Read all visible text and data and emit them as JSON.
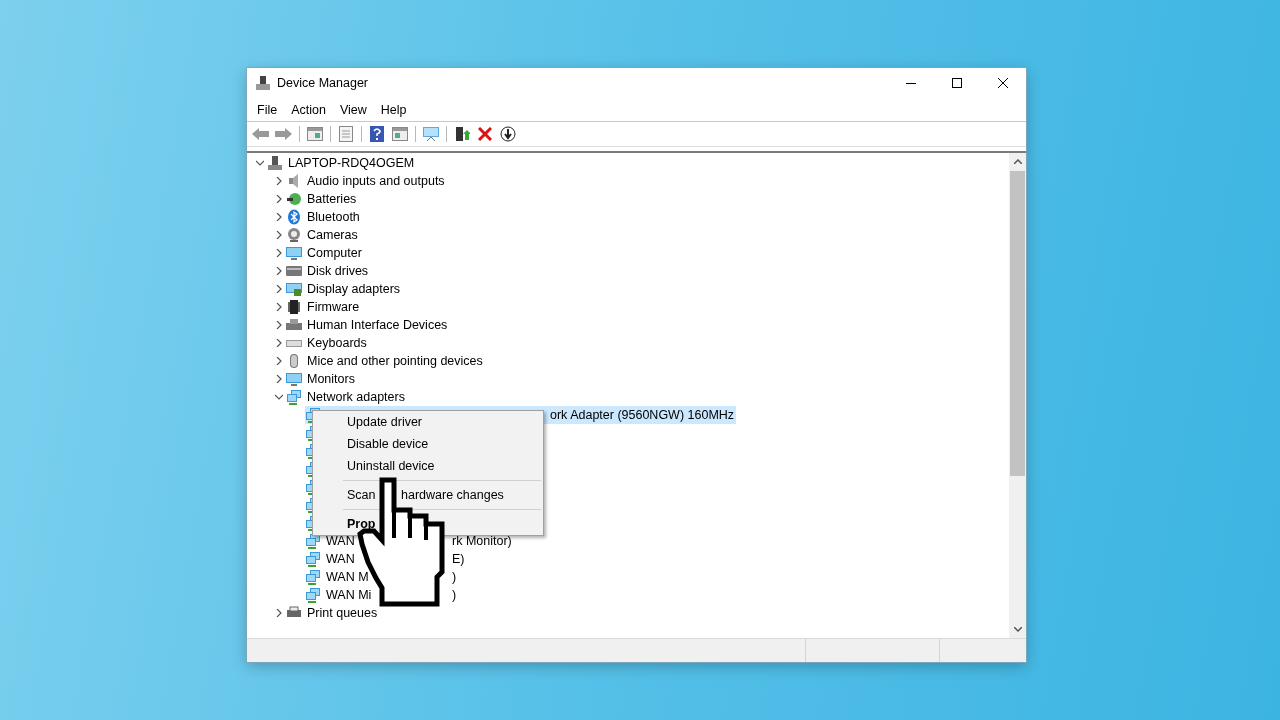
{
  "window": {
    "title": "Device Manager"
  },
  "menu_bar": [
    "File",
    "Action",
    "View",
    "Help"
  ],
  "tree": {
    "label": "LAPTOP-RDQ4OGEM",
    "expanded": true,
    "children": [
      {
        "label": "Audio inputs and outputs",
        "expanded": false
      },
      {
        "label": "Batteries",
        "expanded": false
      },
      {
        "label": "Bluetooth",
        "expanded": false
      },
      {
        "label": "Cameras",
        "expanded": false
      },
      {
        "label": "Computer",
        "expanded": false
      },
      {
        "label": "Disk drives",
        "expanded": false
      },
      {
        "label": "Display adapters",
        "expanded": false
      },
      {
        "label": "Firmware",
        "expanded": false
      },
      {
        "label": "Human Interface Devices",
        "expanded": false
      },
      {
        "label": "Keyboards",
        "expanded": false
      },
      {
        "label": "Mice and other pointing devices",
        "expanded": false
      },
      {
        "label": "Monitors",
        "expanded": false
      },
      {
        "label": "Network adapters",
        "expanded": true,
        "children": [
          {
            "kind": "under_menu",
            "selected": true,
            "label_after": "ork Adapter (9560NGW) 160MHz"
          },
          {
            "kind": "under_menu",
            "selected": false
          },
          {
            "kind": "under_menu",
            "selected": false
          },
          {
            "kind": "under_menu",
            "selected": false
          },
          {
            "kind": "under_menu",
            "selected": false
          },
          {
            "kind": "under_menu",
            "selected": false
          },
          {
            "kind": "under_menu",
            "selected": false
          },
          {
            "kind": "under_cursor",
            "selected": false,
            "label": "WAN",
            "label_after": "rk Monitor)"
          },
          {
            "kind": "under_cursor",
            "selected": false,
            "label": "WAN",
            "label_after": "E)"
          },
          {
            "kind": "under_cursor",
            "selected": false,
            "label": "WAN M",
            "label_after": ")"
          },
          {
            "kind": "under_cursor",
            "selected": false,
            "label": "WAN Mi",
            "label_after": ")"
          }
        ]
      },
      {
        "label": "Print queues",
        "expanded": false
      }
    ]
  },
  "context_menu": {
    "items": [
      {
        "kind": "item",
        "label": "Update driver",
        "default": false
      },
      {
        "kind": "item",
        "label": "Disable device",
        "default": false
      },
      {
        "kind": "item",
        "label": "Uninstall device",
        "default": false
      },
      {
        "kind": "separator"
      },
      {
        "kind": "item",
        "label": "Scan",
        "label_after": "hardware changes",
        "default": false
      },
      {
        "kind": "separator"
      },
      {
        "kind": "item",
        "label": "Prop",
        "default": true
      }
    ]
  }
}
